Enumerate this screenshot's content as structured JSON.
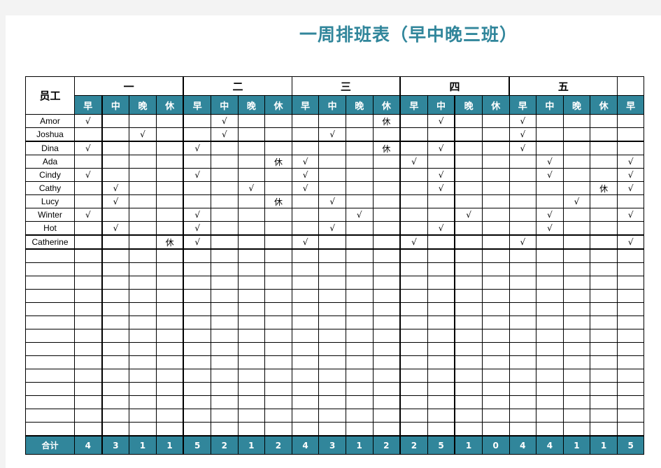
{
  "title": "一周排班表（早中晚三班）",
  "employee_header": "员工",
  "days": [
    "一",
    "二",
    "三",
    "四",
    "五",
    ""
  ],
  "shifts": [
    "早",
    "中",
    "晚",
    "休",
    "早",
    "中",
    "晚",
    "休",
    "早",
    "中",
    "晚",
    "休",
    "早",
    "中",
    "晚",
    "休",
    "早",
    "中",
    "晚",
    "休",
    "早"
  ],
  "rows": [
    {
      "name": "Amor",
      "cells": {
        "0": "√",
        "5": "√",
        "11": "休",
        "13": "√",
        "16": "√"
      }
    },
    {
      "name": "Joshua",
      "cells": {
        "2": "√",
        "5": "√",
        "9": "√",
        "16": "√"
      }
    },
    {
      "name": "Dina",
      "cells": {
        "0": "√",
        "4": "√",
        "11": "休",
        "13": "√",
        "16": "√"
      }
    },
    {
      "name": "Ada",
      "cells": {
        "7": "休",
        "8": "√",
        "12": "√",
        "17": "√",
        "20": "√"
      }
    },
    {
      "name": "Cindy",
      "cells": {
        "0": "√",
        "4": "√",
        "8": "√",
        "13": "√",
        "17": "√",
        "20": "√"
      }
    },
    {
      "name": "Cathy",
      "cells": {
        "1": "√",
        "6": "√",
        "8": "√",
        "13": "√",
        "19": "休",
        "20": "√"
      }
    },
    {
      "name": "Lucy",
      "cells": {
        "1": "√",
        "7": "休",
        "9": "√",
        "18": "√"
      }
    },
    {
      "name": "Winter",
      "cells": {
        "0": "√",
        "4": "√",
        "10": "√",
        "14": "√",
        "17": "√",
        "20": "√"
      }
    },
    {
      "name": "Hot",
      "cells": {
        "1": "√",
        "4": "√",
        "9": "√",
        "13": "√",
        "17": "√"
      }
    },
    {
      "name": "Catherine",
      "cells": {
        "3": "休",
        "4": "√",
        "8": "√",
        "12": "√",
        "16": "√",
        "20": "√"
      }
    }
  ],
  "total_label": "合计",
  "totals": [
    "4",
    "3",
    "1",
    "1",
    "5",
    "2",
    "1",
    "2",
    "4",
    "3",
    "1",
    "2",
    "2",
    "5",
    "1",
    "0",
    "4",
    "4",
    "1",
    "1",
    "5"
  ],
  "colors": {
    "accent": "#31869b"
  }
}
